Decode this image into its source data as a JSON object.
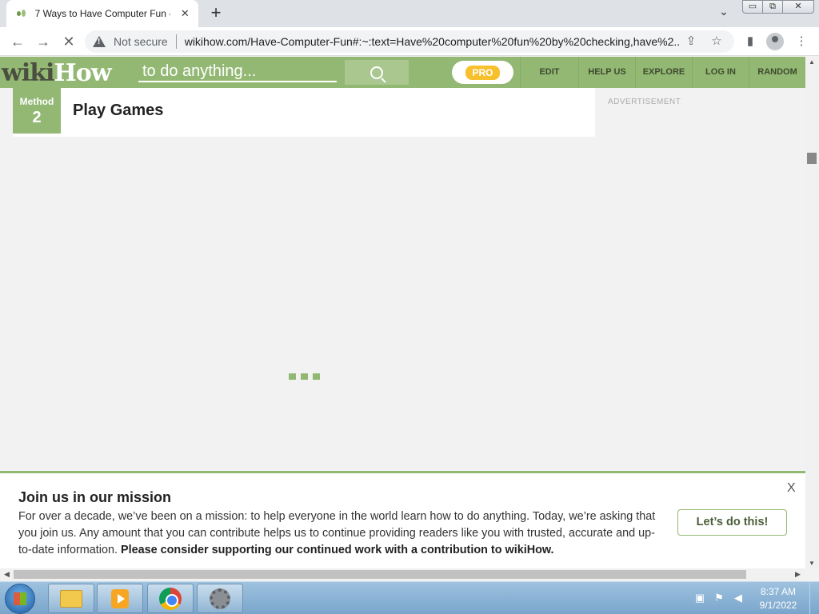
{
  "browser": {
    "tab_title": "7 Ways to Have Computer Fun -",
    "tab_close": "✕",
    "new_tab": "+",
    "tab_dropdown": "⌄",
    "not_secure": "Not secure",
    "url": "wikihow.com/Have-Computer-Fun#:~:text=Have%20computer%20fun%20by%20checking,have%2...",
    "window_controls": {
      "minimize": "▭",
      "restore": "⧉",
      "close": "✕"
    }
  },
  "wikihow": {
    "logo_wiki": "wiki",
    "logo_how": "How",
    "search_placeholder": "to do anything...",
    "pro": "PRO",
    "nav": {
      "edit": "EDIT",
      "help": "HELP US",
      "explore": "EXPLORE",
      "login": "LOG IN",
      "random": "RANDOM"
    },
    "brand_color": "#93b874"
  },
  "content": {
    "method_label": "Method",
    "method_number": "2",
    "method_title": "Play Games",
    "advertisement": "ADVERTISEMENT"
  },
  "banner": {
    "title": "Join us in our mission",
    "body": "For over a decade, we’ve been on a mission: to help everyone in the world learn how to do anything. Today, we’re asking that you join us. Any amount that you can contribute helps us to continue providing readers like you with trusted, accurate and up-to-date information.",
    "body_bold": "Please consider supporting our continued work with a contribution to wikiHow.",
    "button": "Let’s do this!",
    "close": "X"
  },
  "taskbar": {
    "time": "8:37 AM",
    "date": "9/1/2022"
  }
}
